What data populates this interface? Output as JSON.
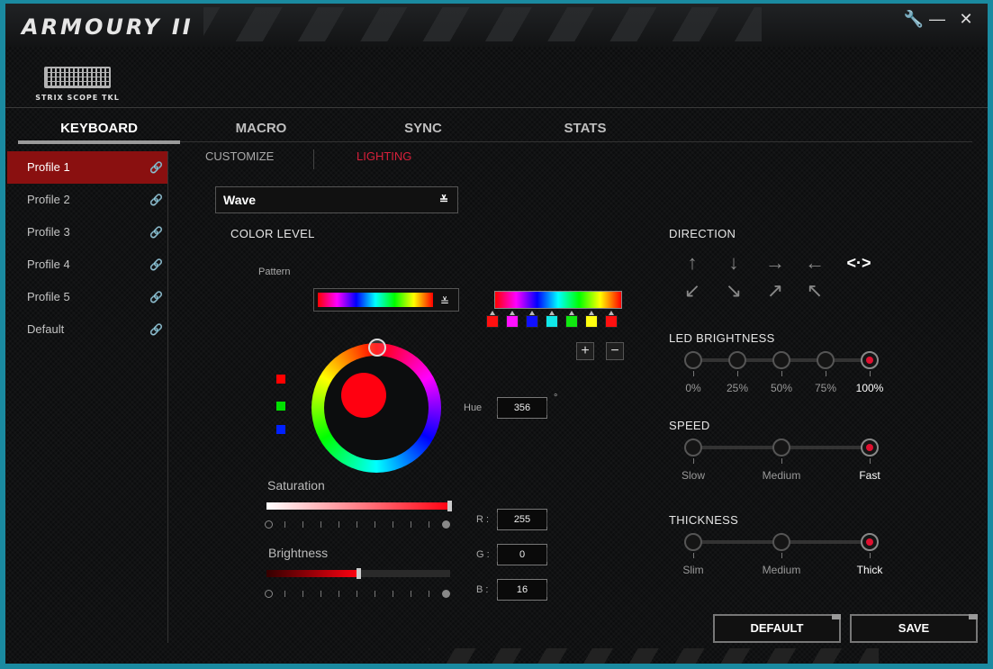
{
  "app": {
    "title": "ARMOURY II",
    "device": "STRIX SCOPE TKL"
  },
  "window_controls": {
    "settings_icon": "wrench-icon",
    "minimize_icon": "minimize-icon",
    "close_icon": "close-icon",
    "minimize_glyph": "—",
    "close_glyph": "✕",
    "settings_glyph": "🔧"
  },
  "tabs": [
    {
      "label": "KEYBOARD",
      "active": true
    },
    {
      "label": "MACRO"
    },
    {
      "label": "SYNC"
    },
    {
      "label": "STATS"
    }
  ],
  "profiles": [
    {
      "label": "Profile 1",
      "active": true
    },
    {
      "label": "Profile 2"
    },
    {
      "label": "Profile 3"
    },
    {
      "label": "Profile 4"
    },
    {
      "label": "Profile 5"
    },
    {
      "label": "Default"
    }
  ],
  "subtabs": {
    "customize": "CUSTOMIZE",
    "lighting": "LIGHTING",
    "active": "lighting"
  },
  "effect": {
    "selected": "Wave"
  },
  "color_level": {
    "title": "COLOR LEVEL",
    "pattern_label": "Pattern",
    "swatches": [
      "#ff1010",
      "#ff10ff",
      "#1010ff",
      "#10e8e8",
      "#10e810",
      "#ffff10",
      "#ff1010"
    ],
    "add_glyph": "+",
    "remove_glyph": "−"
  },
  "color": {
    "hex": "#ff0010",
    "hue_label": "Hue",
    "hue": "356",
    "degree": "°",
    "r_label": "R :",
    "r": "255",
    "g_label": "G :",
    "g": "0",
    "b_label": "B :",
    "b": "16",
    "saturation_label": "Saturation",
    "saturation_level": 1.0,
    "brightness_label": "Brightness",
    "brightness_level": 0.5
  },
  "direction": {
    "title": "DIRECTION",
    "arrows": [
      "↑",
      "↓",
      "→",
      "←",
      "↙",
      "↘",
      "↗",
      "↖"
    ],
    "active_glyph": "<·>"
  },
  "led_brightness": {
    "title": "LED BRIGHTNESS",
    "labels": [
      "0%",
      "25%",
      "50%",
      "75%",
      "100%"
    ],
    "selected": 4
  },
  "speed": {
    "title": "SPEED",
    "labels": [
      "Slow",
      "Medium",
      "Fast"
    ],
    "selected": 2
  },
  "thickness": {
    "title": "THICKNESS",
    "labels": [
      "Slim",
      "Medium",
      "Thick"
    ],
    "selected": 2
  },
  "buttons": {
    "default": "DEFAULT",
    "save": "SAVE"
  },
  "colors": {
    "accent": "#e01030",
    "active_profile": "#8a1010",
    "lighting_tab": "#d8203a"
  }
}
